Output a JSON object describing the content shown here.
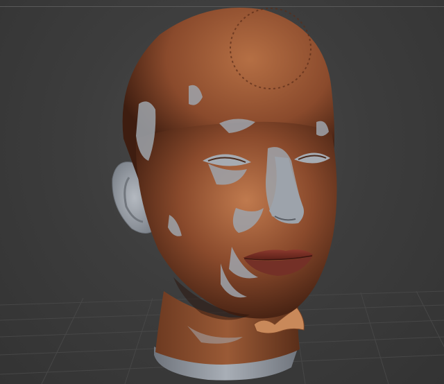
{
  "viewport": {
    "background": "#3b3b3b",
    "grid_color": "#454545"
  },
  "model": {
    "skin_color": "#8a4a2c",
    "skin_highlight": "#c07a4e",
    "clay_color": "#9ea4ac",
    "lip_color": "#7a2f26"
  }
}
